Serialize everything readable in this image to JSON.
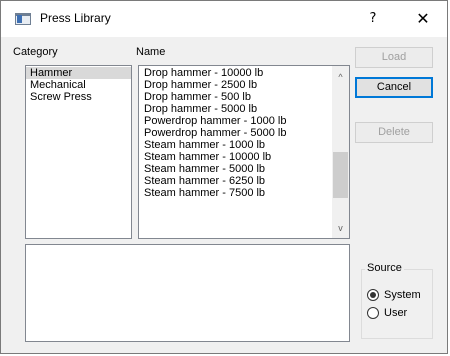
{
  "window": {
    "title": "Press Library",
    "help_glyph": "?",
    "close_glyph": "✕"
  },
  "category": {
    "label": "Category",
    "items": [
      "Hammer",
      "Mechanical",
      "Screw Press"
    ],
    "selected_index": 0
  },
  "name": {
    "label": "Name",
    "items": [
      "Drop hammer - 10000 lb",
      "Drop hammer - 2500 lb",
      "Drop hammer - 500 lb",
      "Drop hammer - 5000 lb",
      "Powerdrop hammer - 1000 lb",
      "Powerdrop hammer - 5000 lb",
      "Steam hammer - 1000 lb",
      "Steam hammer - 10000 lb",
      "Steam hammer - 5000 lb",
      "Steam hammer - 6250 lb",
      "Steam hammer - 7500 lb"
    ],
    "scroll_up_glyph": "^",
    "scroll_down_glyph": "v"
  },
  "buttons": {
    "load": "Load",
    "cancel": "Cancel",
    "delete": "Delete"
  },
  "source": {
    "label": "Source",
    "options": [
      "System",
      "User"
    ],
    "selected": "System"
  }
}
